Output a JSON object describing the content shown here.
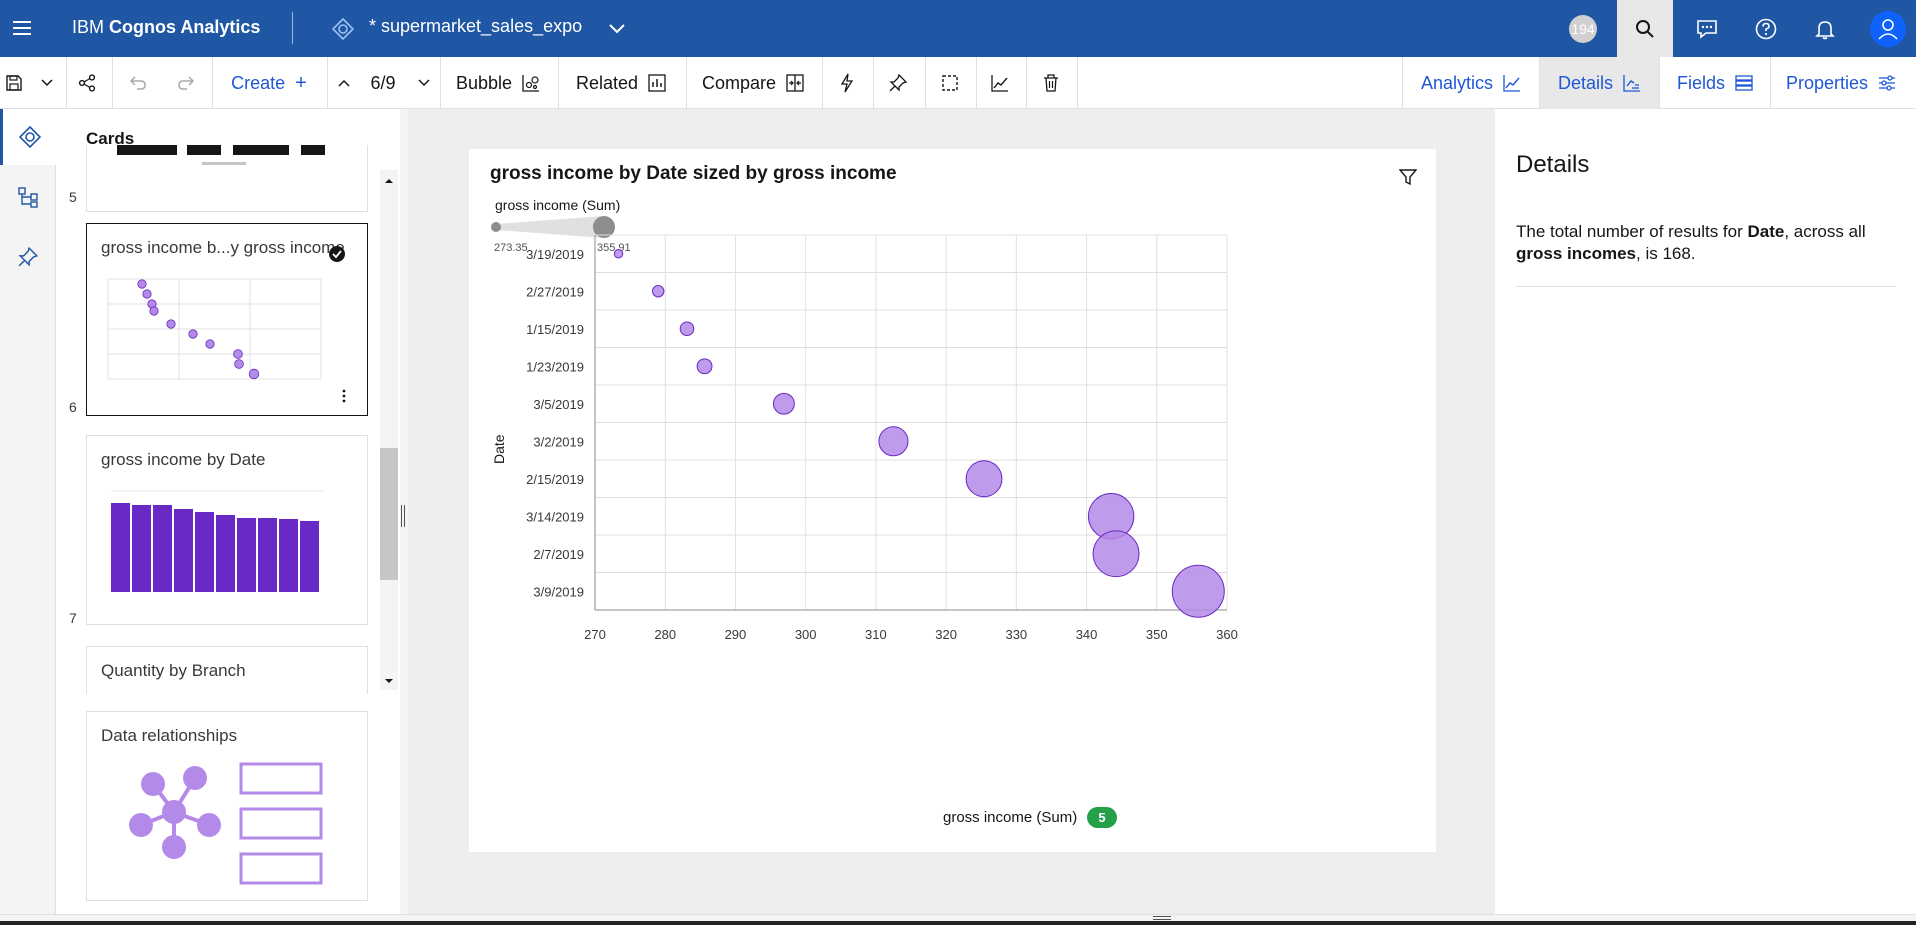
{
  "app": {
    "brand_prefix": "IBM ",
    "brand_bold": "Cognos Analytics",
    "doc_title": "* supermarket_sales_expo",
    "notification_count": "194"
  },
  "toolbar": {
    "create_label": "Create",
    "page_indicator": "6/9",
    "viz_type": "Bubble",
    "related_label": "Related",
    "compare_label": "Compare",
    "analytics_label": "Analytics",
    "details_label": "Details",
    "fields_label": "Fields",
    "properties_label": "Properties"
  },
  "cards_panel": {
    "title": "Cards",
    "cards": [
      {
        "number": "5",
        "title": ""
      },
      {
        "number": "6",
        "title": "gross income b...y gross income"
      },
      {
        "number": "7",
        "title": "gross income by Date"
      },
      {
        "number": "",
        "title": "Quantity by Branch"
      },
      {
        "number": "",
        "title": "Data relationships"
      }
    ]
  },
  "chart": {
    "title": "gross income by Date sized by gross income",
    "size_legend_label": "gross income (Sum)",
    "size_min": "273.35",
    "size_max": "355.91",
    "x_axis_label": "gross income (Sum)",
    "y_axis_label": "Date",
    "x_badge": "5"
  },
  "chart_data": {
    "type": "scatter",
    "title": "gross income by Date sized by gross income",
    "xlabel": "gross income (Sum)",
    "ylabel": "Date",
    "xlim": [
      270,
      360
    ],
    "x_ticks": [
      270,
      280,
      290,
      300,
      310,
      320,
      330,
      340,
      350,
      360
    ],
    "grid": true,
    "categories": [
      "3/19/2019",
      "2/27/2019",
      "1/15/2019",
      "1/23/2019",
      "3/5/2019",
      "3/2/2019",
      "2/15/2019",
      "3/14/2019",
      "2/7/2019",
      "3/9/2019"
    ],
    "values": [
      273.35,
      279.0,
      283.1,
      285.6,
      296.9,
      312.5,
      325.4,
      343.5,
      344.2,
      355.91
    ],
    "color": "#b48ae8"
  },
  "details_panel": {
    "title": "Details",
    "text_1": "The total number of results for ",
    "text_bold_1": "Date",
    "text_2": ", across all ",
    "text_bold_2": "gross incomes",
    "text_3": ", is 168."
  }
}
